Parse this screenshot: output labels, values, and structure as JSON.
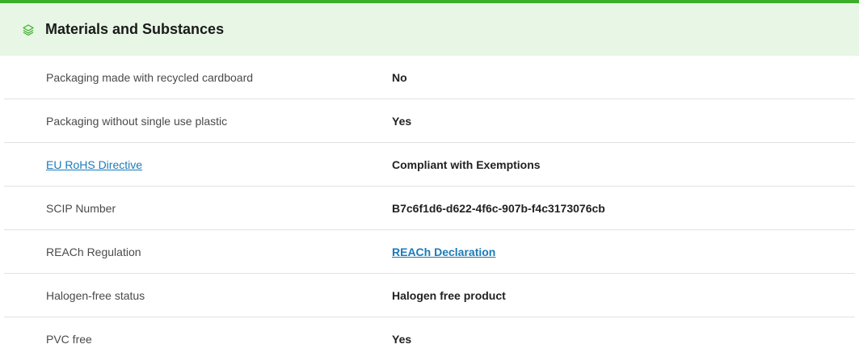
{
  "section": {
    "title": "Materials and Substances",
    "icon": "layers-icon",
    "accent_color": "#3dae2b",
    "header_background": "#e7f6e5"
  },
  "rows": [
    {
      "label": "Packaging made with recycled cardboard",
      "value": "No"
    },
    {
      "label": "Packaging without single use plastic",
      "value": "Yes"
    },
    {
      "label": "EU RoHS Directive",
      "value": "Compliant with Exemptions"
    },
    {
      "label": "SCIP Number",
      "value": "B7c6f1d6-d622-4f6c-907b-f4c3173076cb"
    },
    {
      "label": "REACh Regulation",
      "value": "REACh Declaration"
    },
    {
      "label": "Halogen-free status",
      "value": "Halogen free product"
    },
    {
      "label": "PVC free",
      "value": "Yes"
    }
  ],
  "link_color": "#1a7bb9"
}
